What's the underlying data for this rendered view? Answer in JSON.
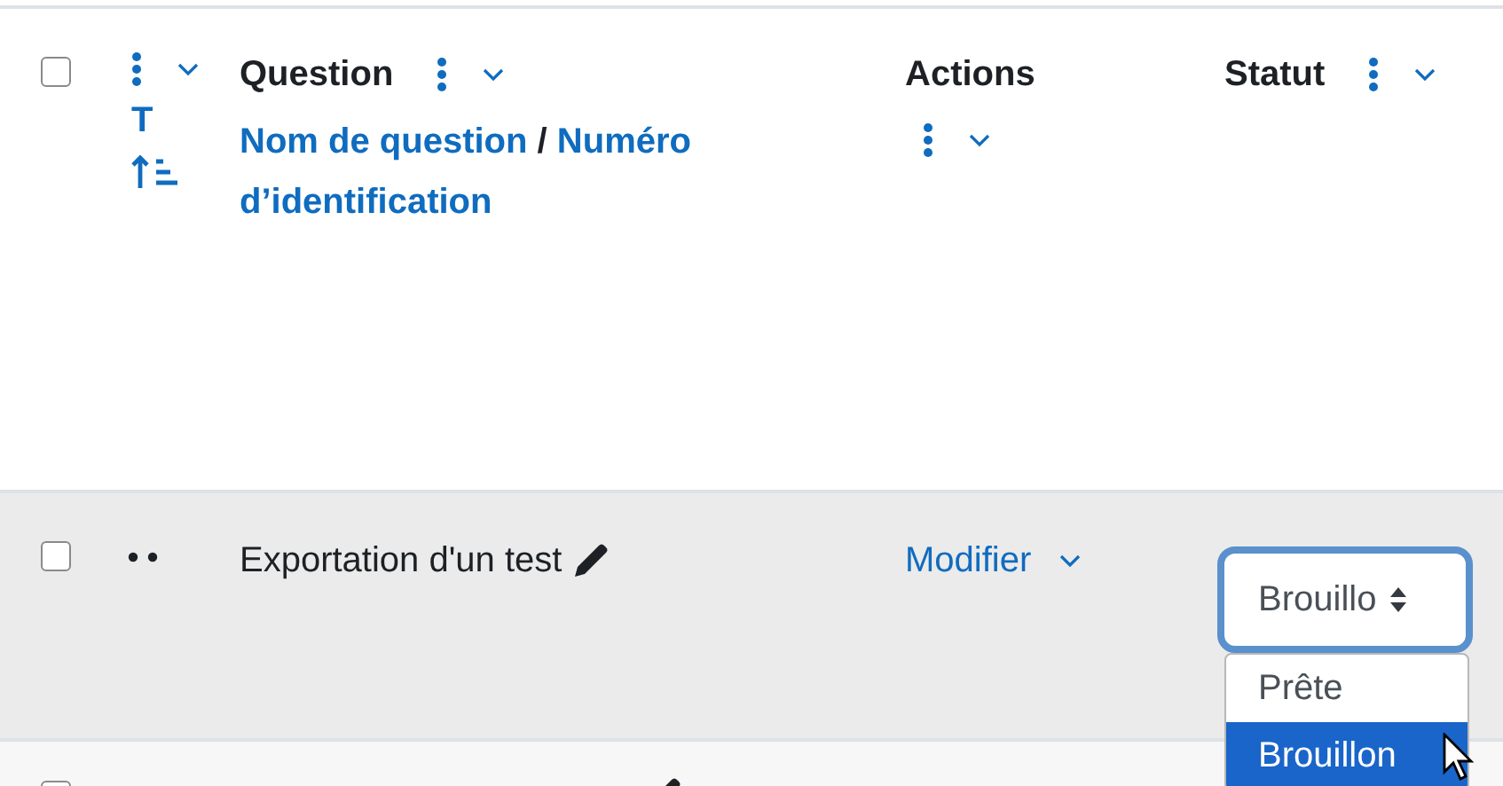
{
  "header": {
    "select_all_checked": false,
    "type_column": {
      "label": "T"
    },
    "question_column": {
      "title": "Question",
      "links": [
        "Nom de question",
        "Numéro d’identification"
      ],
      "separator": "/"
    },
    "actions_column": {
      "title": "Actions"
    },
    "status_column": {
      "title": "Statut"
    }
  },
  "rows": [
    {
      "kind": "question",
      "checked": false,
      "highlighted": true,
      "name": "Exportation d'un test",
      "action": "Modifier",
      "status": {
        "value": "Brouillo",
        "open": true,
        "options": [
          {
            "label": "Prête",
            "selected": false
          },
          {
            "label": "Brouillon",
            "selected": true
          }
        ]
      }
    },
    {
      "kind": "partial",
      "checked": false,
      "highlighted": false
    }
  ]
}
